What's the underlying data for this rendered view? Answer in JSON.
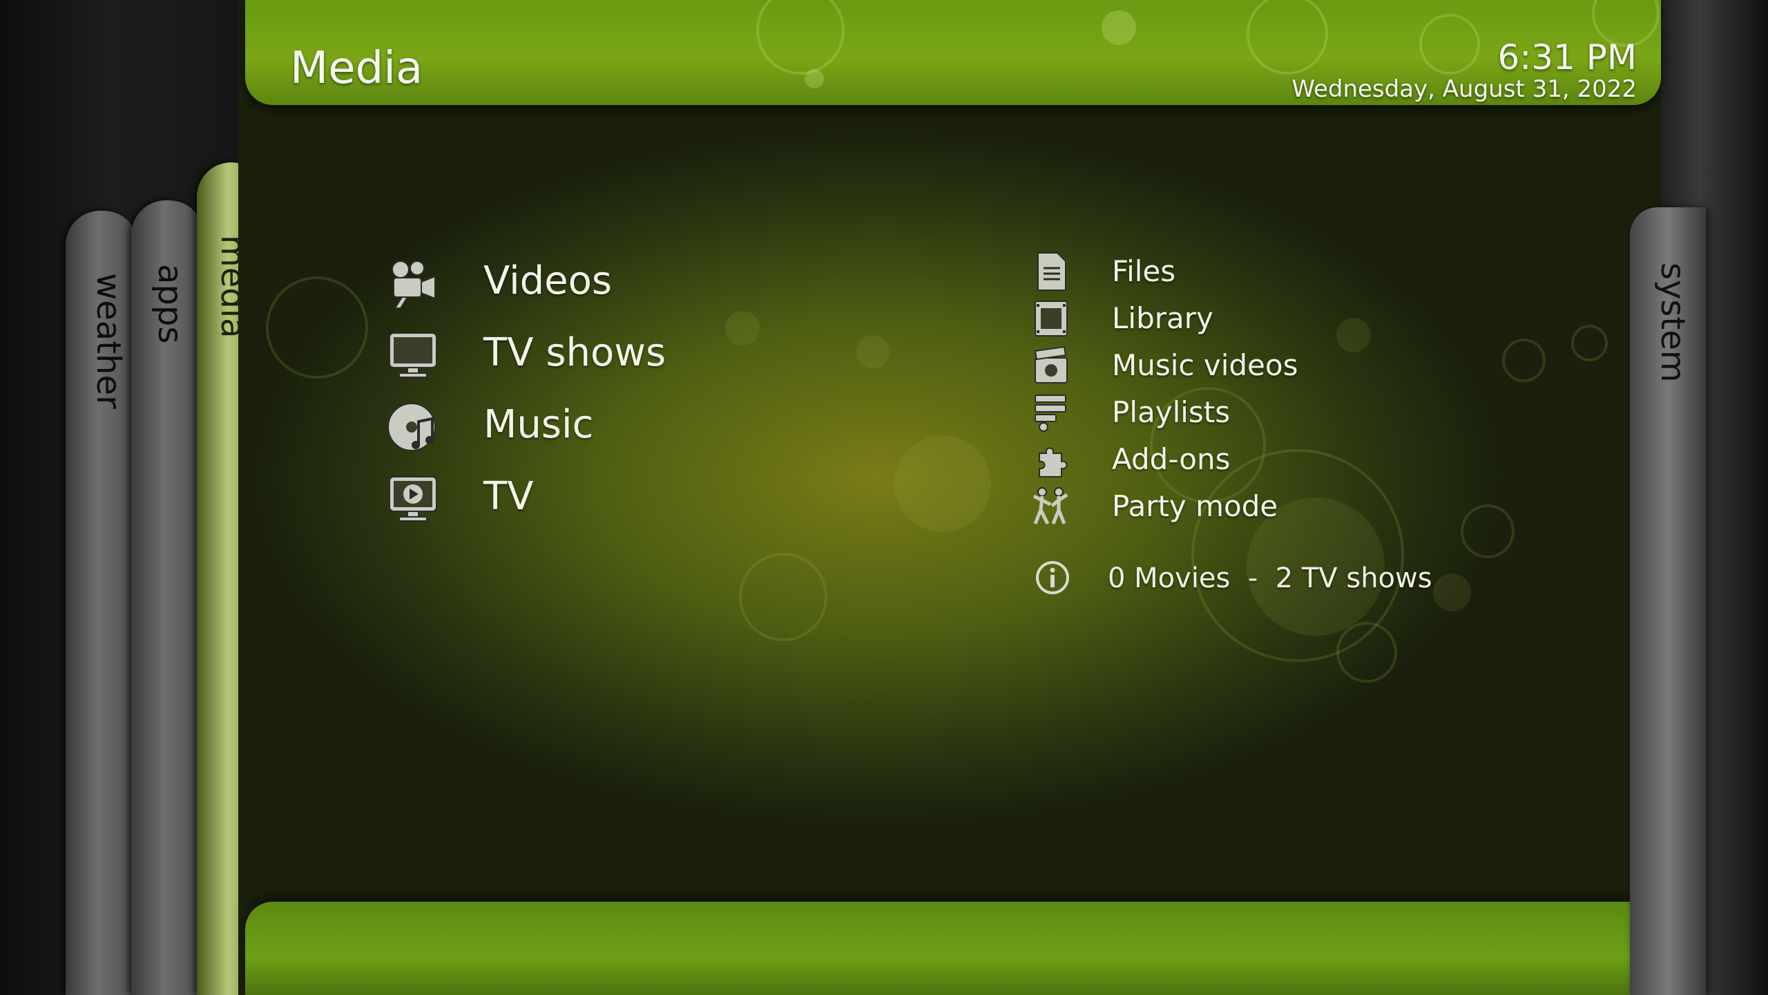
{
  "header": {
    "title": "Media",
    "time": "6:31 PM",
    "date": "Wednesday, August 31, 2022"
  },
  "side_tabs": {
    "left": [
      {
        "label": "weather",
        "icon": "weather-tab"
      },
      {
        "label": "apps",
        "icon": "apps-tab"
      },
      {
        "label": "media",
        "icon": "media-tab",
        "active": true
      }
    ],
    "right": {
      "label": "system"
    }
  },
  "main_menu": [
    {
      "label": "Videos",
      "icon": "video-camera-icon"
    },
    {
      "label": "TV shows",
      "icon": "monitor-icon"
    },
    {
      "label": "Music",
      "icon": "music-disc-icon"
    },
    {
      "label": "TV",
      "icon": "tv-play-icon"
    }
  ],
  "sub_menu": [
    {
      "label": "Files",
      "icon": "document-icon"
    },
    {
      "label": "Library",
      "icon": "film-strip-icon"
    },
    {
      "label": "Music videos",
      "icon": "clapperboard-icon"
    },
    {
      "label": "Playlists",
      "icon": "playlist-icon"
    },
    {
      "label": "Add-ons",
      "icon": "puzzle-icon"
    },
    {
      "label": "Party mode",
      "icon": "party-icon"
    }
  ],
  "info": {
    "text": "0 Movies  -  2 TV shows",
    "icon": "info-icon"
  },
  "colors": {
    "accent_green": "#7aa616",
    "panel_center": "#7a7c16",
    "text": "#f3f5ea"
  }
}
